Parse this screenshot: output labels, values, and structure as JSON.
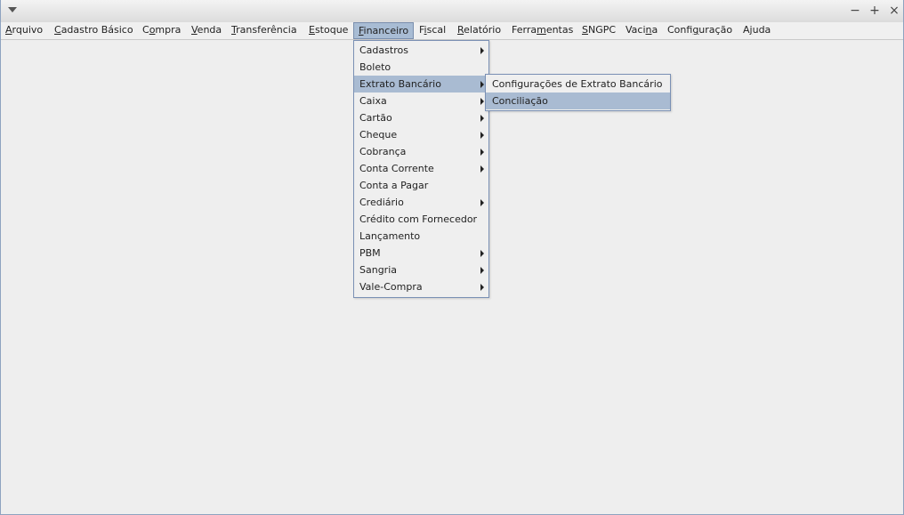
{
  "window": {
    "title": "",
    "minimize": "−",
    "maximize": "+",
    "close": "×"
  },
  "menubar": [
    {
      "key": "arquivo",
      "pre": "",
      "mn": "A",
      "post": "rquivo"
    },
    {
      "key": "cadastro-basico",
      "pre": "",
      "mn": "C",
      "post": "adastro Básico"
    },
    {
      "key": "compra",
      "pre": "C",
      "mn": "o",
      "post": "mpra"
    },
    {
      "key": "venda",
      "pre": "",
      "mn": "V",
      "post": "enda"
    },
    {
      "key": "transferencia",
      "pre": "",
      "mn": "T",
      "post": "ransferência"
    },
    {
      "key": "estoque",
      "pre": "",
      "mn": "E",
      "post": "stoque"
    },
    {
      "key": "financeiro",
      "pre": "",
      "mn": "F",
      "post": "inanceiro"
    },
    {
      "key": "fiscal",
      "pre": "F",
      "mn": "i",
      "post": "scal"
    },
    {
      "key": "relatorio",
      "pre": "",
      "mn": "R",
      "post": "elatório"
    },
    {
      "key": "ferramentas",
      "pre": "Ferra",
      "mn": "m",
      "post": "entas"
    },
    {
      "key": "sngpc",
      "pre": "",
      "mn": "S",
      "post": "NGPC"
    },
    {
      "key": "vacina",
      "pre": "Vaci",
      "mn": "n",
      "post": "a"
    },
    {
      "key": "configuracao",
      "pre": "Confi",
      "mn": "g",
      "post": "uração"
    },
    {
      "key": "ajuda",
      "pre": "A",
      "mn": "j",
      "post": "uda"
    }
  ],
  "financeiro_menu": [
    {
      "label": "Cadastros",
      "submenu": true
    },
    {
      "label": "Boleto",
      "submenu": false
    },
    {
      "label": "Extrato Bancário",
      "submenu": true
    },
    {
      "label": "Caixa",
      "submenu": true
    },
    {
      "label": "Cartão",
      "submenu": true
    },
    {
      "label": "Cheque",
      "submenu": true
    },
    {
      "label": "Cobrança",
      "submenu": true
    },
    {
      "label": "Conta Corrente",
      "submenu": true
    },
    {
      "label": "Conta a Pagar",
      "submenu": false
    },
    {
      "label": "Crediário",
      "submenu": true
    },
    {
      "label": "Crédito com Fornecedor",
      "submenu": false
    },
    {
      "label": "Lançamento",
      "submenu": false
    },
    {
      "label": "PBM",
      "submenu": true
    },
    {
      "label": "Sangria",
      "submenu": true
    },
    {
      "label": "Vale-Compra",
      "submenu": true
    }
  ],
  "extrato_submenu": [
    {
      "label": "Configurações de Extrato Bancário"
    },
    {
      "label": "Conciliação"
    }
  ]
}
